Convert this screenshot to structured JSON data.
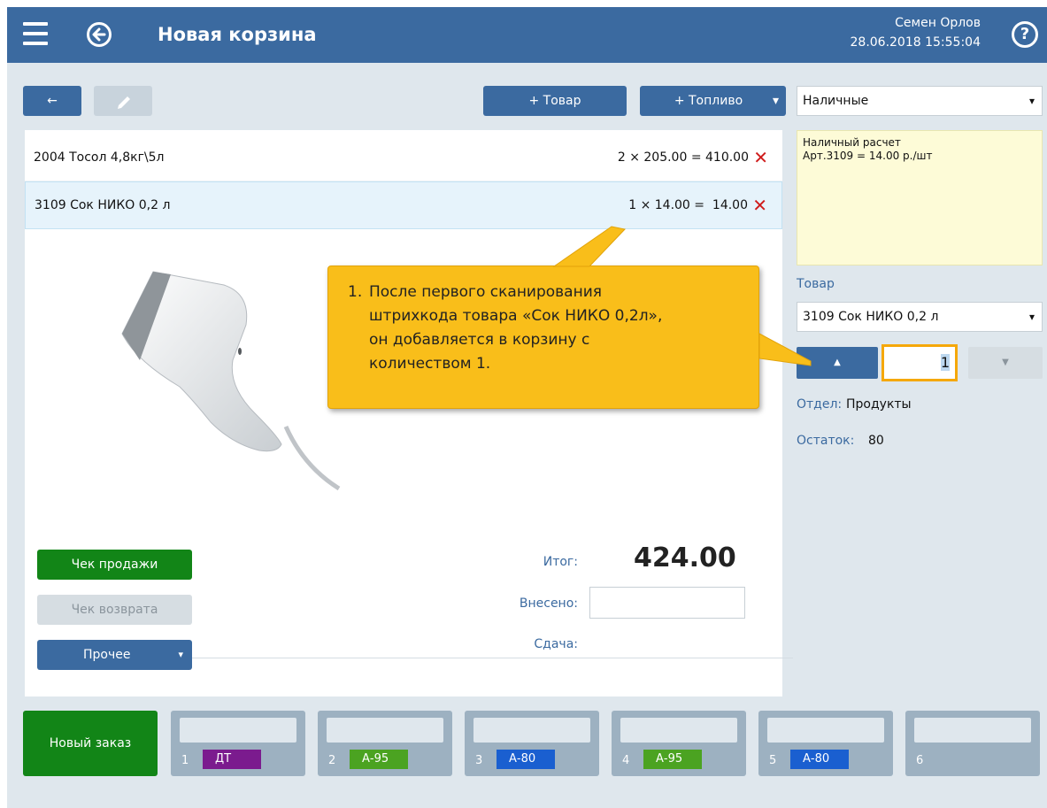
{
  "header": {
    "title": "Новая корзина",
    "user": "Семен Орлов",
    "datetime": "28.06.2018 15:55:04",
    "help": "?"
  },
  "toolbar": {
    "back_symbol": "←",
    "add_item_label": "+ Товар",
    "add_fuel_label": "+ Топливо",
    "dropdown_arrow": "▾"
  },
  "cart": {
    "rows": [
      {
        "code_name": "2004 Тосол 4,8кг\\5л",
        "calc": "2 × 205.00 = 410.00",
        "selected": false
      },
      {
        "code_name": "3109 Сок НИКО 0,2 л",
        "calc": "1 × 14.00 =  14.00",
        "selected": true
      }
    ],
    "delete_symbol": "✕"
  },
  "actions": {
    "sale_receipt": "Чек продажи",
    "return_receipt": "Чек возврата",
    "other": "Прочее",
    "other_arrow": "▾"
  },
  "totals": {
    "total_label": "Итог:",
    "total_value": "424.00",
    "paid_label": "Внесено:",
    "paid_value": "",
    "change_label": "Сдача:"
  },
  "side": {
    "payment_select": "Наличные",
    "select_arrow": "▾",
    "note_line1": "Наличный расчет",
    "note_line2": "Арт.3109 = 14.00 р./шт",
    "product_label": "Товар",
    "product_select": "3109  Сок НИКО 0,2 л",
    "qty_up": "▲",
    "qty_down": "▼",
    "qty_value": "1",
    "dept_label": "Отдел:",
    "dept_value": "Продукты",
    "stock_label": "Остаток:",
    "stock_value": "80"
  },
  "orders": {
    "new_order": "Новый заказ",
    "tabs": [
      {
        "num": "1",
        "fuel": "ДТ",
        "color": "#7b1b8e"
      },
      {
        "num": "2",
        "fuel": "А-95",
        "color": "#4ba321"
      },
      {
        "num": "3",
        "fuel": "А-80",
        "color": "#1a5fd0"
      },
      {
        "num": "4",
        "fuel": "А-95",
        "color": "#4ba321"
      },
      {
        "num": "5",
        "fuel": "А-80",
        "color": "#1a5fd0"
      },
      {
        "num": "6",
        "fuel": "",
        "color": ""
      }
    ]
  },
  "callout": {
    "number": "1.",
    "line1": "После первого сканирования",
    "line2": "штрихкода товара «Сок НИКО 0,2л»,",
    "line3": "он добавляется в корзину с",
    "line4": "количеством 1."
  }
}
